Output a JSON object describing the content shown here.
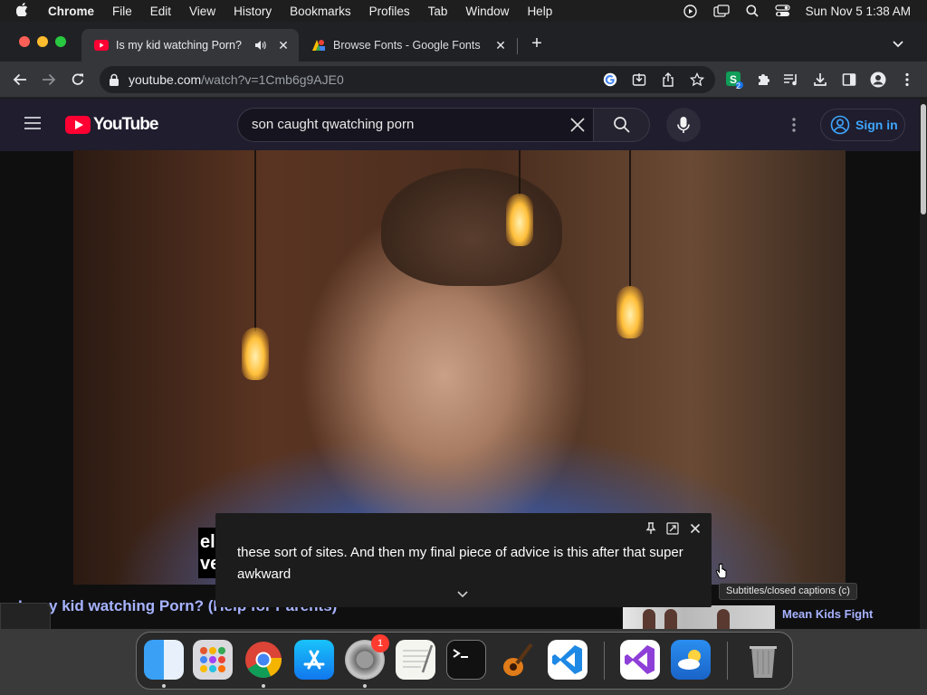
{
  "menubar": {
    "app_name": "Chrome",
    "items": [
      "File",
      "Edit",
      "View",
      "History",
      "Bookmarks",
      "Profiles",
      "Tab",
      "Window",
      "Help"
    ],
    "clock": "Sun Nov 5  1:38 AM"
  },
  "tabs": [
    {
      "title": "Is my kid watching Porn? (",
      "active": true
    },
    {
      "title": "Browse Fonts - Google Fonts",
      "active": false
    }
  ],
  "address_bar": {
    "host": "youtube.com",
    "path": "/watch?v=1Cmb6g9AJE0"
  },
  "extensions": {
    "badge_count": "2"
  },
  "youtube": {
    "logo_text": "YouTube",
    "search_query": "son caught qwatching porn",
    "sign_in_label": "Sign in",
    "video_title": "Is my kid watching Porn? (Help for Parents)",
    "side_video_title": "Mean Kids Fight"
  },
  "captions": {
    "partial_left": "el\nve",
    "text": "these sort of sites. And then my final piece of advice is this after that super awkward",
    "tooltip": "Subtitles/closed captions (c)"
  },
  "dock": {
    "apps": [
      "finder-icon",
      "launchpad-icon",
      "chrome-icon",
      "app-store-icon",
      "system-settings-icon",
      "textedit-icon",
      "terminal-icon",
      "garageband-icon",
      "vscode-icon",
      "visual-studio-icon",
      "weather-icon",
      "trash-icon"
    ],
    "settings_badge": "1"
  },
  "colors": {
    "youtube_red": "#ff0033",
    "link_blue": "#3ea6ff",
    "title_blue": "#a7b3ff",
    "tab_active": "#35363a"
  }
}
